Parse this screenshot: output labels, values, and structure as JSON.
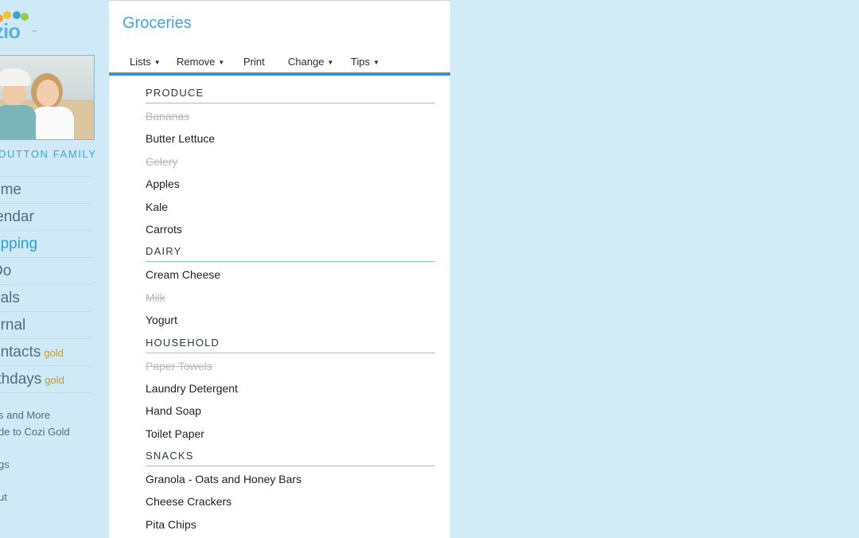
{
  "sidebar": {
    "logo_text": "zio",
    "family_name": "DUTTON FAMILY",
    "nav": [
      {
        "label": "ome",
        "active": false,
        "gold": ""
      },
      {
        "label": "lendar",
        "active": false,
        "gold": ""
      },
      {
        "label": "opping",
        "active": true,
        "gold": ""
      },
      {
        "label": " Do",
        "active": false,
        "gold": ""
      },
      {
        "label": "eals",
        "active": false,
        "gold": ""
      },
      {
        "label": "urnal",
        "active": false,
        "gold": ""
      },
      {
        "label": "ontacts",
        "active": false,
        "gold": "gold"
      },
      {
        "label": "rthdays",
        "active": false,
        "gold": "gold"
      }
    ],
    "links": [
      "s and More",
      "de to Cozi Gold",
      "",
      "gs",
      "",
      "ut"
    ]
  },
  "main": {
    "title": "Groceries",
    "toolbar": [
      {
        "label": "Lists",
        "caret": true
      },
      {
        "label": "Remove",
        "caret": true
      },
      {
        "label": "Print",
        "caret": false
      },
      {
        "label": "Change",
        "caret": true
      },
      {
        "label": "Tips",
        "caret": true
      }
    ],
    "sections": [
      {
        "name": "PRODUCE",
        "items": [
          {
            "text": "Bananas",
            "done": true
          },
          {
            "text": "Butter Lettuce",
            "done": false
          },
          {
            "text": "Celery",
            "done": true
          },
          {
            "text": "Apples",
            "done": false
          },
          {
            "text": "Kale",
            "done": false
          },
          {
            "text": "Carrots",
            "done": false
          }
        ]
      },
      {
        "name": "DAIRY",
        "items": [
          {
            "text": "Cream Cheese",
            "done": false
          },
          {
            "text": "Milk",
            "done": true
          },
          {
            "text": "Yogurt",
            "done": false
          }
        ]
      },
      {
        "name": "HOUSEHOLD",
        "items": [
          {
            "text": "Paper Towels",
            "done": true
          },
          {
            "text": "Laundry Detergent",
            "done": false
          },
          {
            "text": "Hand Soap",
            "done": false
          },
          {
            "text": "Toilet Paper",
            "done": false
          }
        ]
      },
      {
        "name": "SNACKS",
        "items": [
          {
            "text": "Granola - Oats and Honey Bars",
            "done": false
          },
          {
            "text": "Cheese Crackers",
            "done": false
          },
          {
            "text": "Pita Chips",
            "done": false
          }
        ]
      }
    ]
  },
  "colors": {
    "accent": "#3fa6da",
    "page_bg": "#d1ebf7",
    "gold": "#d59a17"
  }
}
